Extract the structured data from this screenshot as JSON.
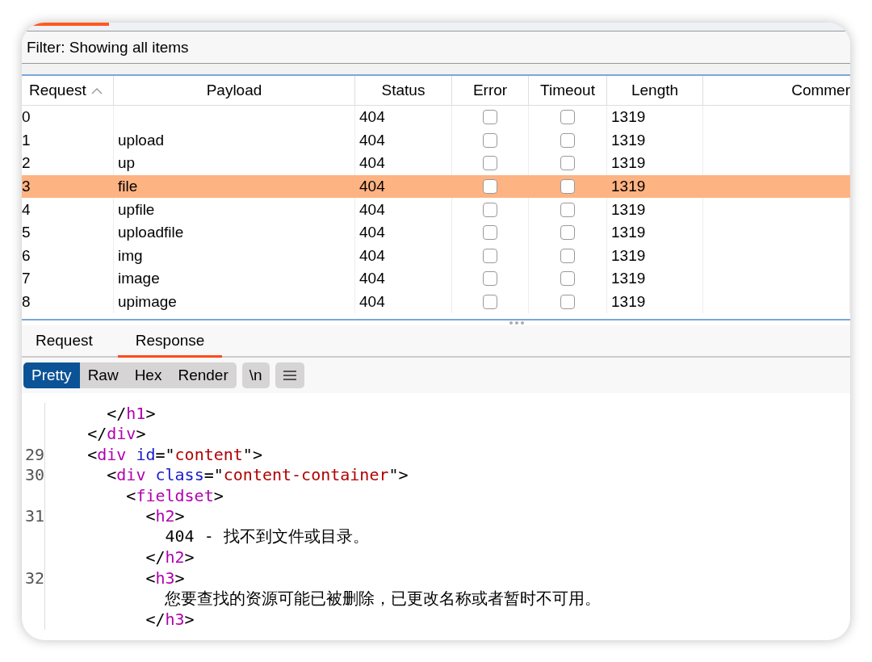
{
  "filter": {
    "text": "Filter: Showing all items"
  },
  "table": {
    "columns": [
      {
        "label": "Request",
        "sorted": true
      },
      {
        "label": "Payload",
        "sorted": false
      },
      {
        "label": "Status",
        "sorted": false
      },
      {
        "label": "Error",
        "sorted": false
      },
      {
        "label": "Timeout",
        "sorted": false
      },
      {
        "label": "Length",
        "sorted": false
      },
      {
        "label": "Commer",
        "sorted": false
      }
    ],
    "rows": [
      {
        "request": "0",
        "status": "404",
        "error": false,
        "timeout": false,
        "length": "1319",
        "selected": false
      },
      {
        "request": "1",
        "payload": "upload",
        "status": "404",
        "error": false,
        "timeout": false,
        "length": "1319",
        "selected": false
      },
      {
        "request": "2",
        "payload": "up",
        "status": "404",
        "error": false,
        "timeout": false,
        "length": "1319",
        "selected": false
      },
      {
        "request": "3",
        "payload": "file",
        "status": "404",
        "error": false,
        "timeout": false,
        "length": "1319",
        "selected": true
      },
      {
        "request": "4",
        "payload": "upfile",
        "status": "404",
        "error": false,
        "timeout": false,
        "length": "1319",
        "selected": false
      },
      {
        "request": "5",
        "payload": "uploadfile",
        "status": "404",
        "error": false,
        "timeout": false,
        "length": "1319",
        "selected": false
      },
      {
        "request": "6",
        "payload": "img",
        "status": "404",
        "error": false,
        "timeout": false,
        "length": "1319",
        "selected": false
      },
      {
        "request": "7",
        "payload": "image",
        "status": "404",
        "error": false,
        "timeout": false,
        "length": "1319",
        "selected": false
      },
      {
        "request": "8",
        "payload": "upimage",
        "status": "404",
        "error": false,
        "timeout": false,
        "length": "1319",
        "selected": false
      }
    ]
  },
  "message_tabs": [
    {
      "label": "Request",
      "selected": false
    },
    {
      "label": "Response",
      "selected": true
    }
  ],
  "view_modes": [
    {
      "label": "Pretty",
      "selected": true
    },
    {
      "label": "Raw",
      "selected": false
    },
    {
      "label": "Hex",
      "selected": false
    },
    {
      "label": "Render",
      "selected": false
    }
  ],
  "toolbar_buttons": [
    {
      "kind": "text",
      "label": "\\n"
    },
    {
      "kind": "menu"
    }
  ],
  "code": {
    "lines": [
      {
        "tokens": [
          {
            "kind": "punct",
            "text": "      </"
          },
          {
            "kind": "tag",
            "text": "h1"
          },
          {
            "kind": "punct",
            "text": ">"
          }
        ]
      },
      {
        "tokens": [
          {
            "kind": "punct",
            "text": "    </"
          },
          {
            "kind": "tag",
            "text": "div"
          },
          {
            "kind": "punct",
            "text": ">"
          }
        ]
      },
      {
        "number": "29",
        "tokens": [
          {
            "kind": "punct",
            "text": "    <"
          },
          {
            "kind": "tag",
            "text": "div"
          },
          {
            "kind": "attr",
            "text": " id"
          },
          {
            "kind": "punct",
            "text": "=\""
          },
          {
            "kind": "str",
            "text": "content"
          },
          {
            "kind": "punct",
            "text": "\">"
          }
        ]
      },
      {
        "number": "30",
        "tokens": [
          {
            "kind": "punct",
            "text": "      <"
          },
          {
            "kind": "tag",
            "text": "div"
          },
          {
            "kind": "attr",
            "text": " class"
          },
          {
            "kind": "punct",
            "text": "=\""
          },
          {
            "kind": "str",
            "text": "content-container"
          },
          {
            "kind": "punct",
            "text": "\">"
          }
        ]
      },
      {
        "tokens": [
          {
            "kind": "punct",
            "text": "        <"
          },
          {
            "kind": "tag",
            "text": "fieldset"
          },
          {
            "kind": "punct",
            "text": ">"
          }
        ]
      },
      {
        "number": "31",
        "tokens": [
          {
            "kind": "punct",
            "text": "          <"
          },
          {
            "kind": "tag",
            "text": "h2"
          },
          {
            "kind": "punct",
            "text": ">"
          }
        ]
      },
      {
        "tokens": [
          {
            "kind": "text",
            "text": "            404 - 找不到文件或目录。"
          }
        ]
      },
      {
        "tokens": [
          {
            "kind": "punct",
            "text": "          </"
          },
          {
            "kind": "tag",
            "text": "h2"
          },
          {
            "kind": "punct",
            "text": ">"
          }
        ]
      },
      {
        "number": "32",
        "tokens": [
          {
            "kind": "punct",
            "text": "          <"
          },
          {
            "kind": "tag",
            "text": "h3"
          },
          {
            "kind": "punct",
            "text": ">"
          }
        ]
      },
      {
        "tokens": [
          {
            "kind": "text",
            "text": "            您要查找的资源可能已被删除，已更改名称或者暂时不可用。"
          }
        ]
      },
      {
        "tokens": [
          {
            "kind": "punct",
            "text": "          </"
          },
          {
            "kind": "tag",
            "text": "h3"
          },
          {
            "kind": "punct",
            "text": ">"
          }
        ]
      }
    ]
  }
}
